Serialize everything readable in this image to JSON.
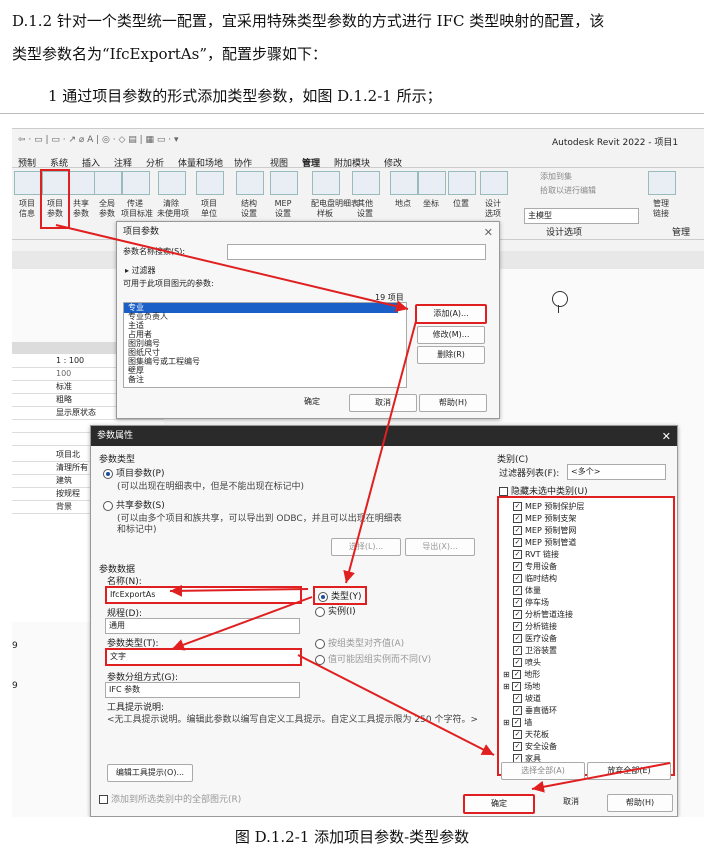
{
  "doc": {
    "para1_line1": "D.1.2  针对一个类型统一配置，宜采用特殊类型参数的方式进行 IFC 类型映射的配置，该",
    "para1_line2": "类型参数名为“IfcExportAs”，配置步骤如下：",
    "step1": "1 通过项目参数的形式添加类型参数，如图 D.1.2-1 所示；",
    "caption": "图 D.1.2-1 添加项目参数-类型参数"
  },
  "revit": {
    "title": "Autodesk Revit 2022 - 项目1",
    "tabs": [
      "预制",
      "系统",
      "插入",
      "注释",
      "分析",
      "体量和场地",
      "协作",
      "视图",
      "管理",
      "附加模块",
      "修改"
    ],
    "ribbon_buttons": [
      "项目\n信息",
      "项目\n参数",
      "共享\n参数",
      "全局\n参数",
      "传递\n项目标准",
      "清除\n未使用项",
      "项目\n单位",
      "结构\n设置",
      "MEP\n设置",
      "配电盘明细表\n样板",
      "其他\n设置",
      "地点",
      "坐标",
      "位置",
      "设计\n选项",
      "管理\n链接"
    ],
    "design_options": {
      "add_to_set": "添加到集",
      "pick_edit": "拾取以进行编辑",
      "main_model": "主模型",
      "group_label": "设计选项"
    },
    "manage_label": "管理",
    "properties": {
      "scale": "1 : 100",
      "scale_value": "100",
      "detail": "标准",
      "visual": "粗略",
      "display": "显示原状态",
      "rows2": [
        "项目北",
        "清理所有",
        "建筑",
        "按规程",
        "背景"
      ]
    },
    "left_marks": [
      "9",
      "9"
    ]
  },
  "project_params": {
    "title": "项目参数",
    "search_label": "参数名称搜索(S):",
    "filter_label": "过滤器",
    "available_label": "可用于此项目图元的参数:",
    "count": "19 项目",
    "items": [
      "专业",
      "专业负责人",
      "主适",
      "占用者",
      "图別编号",
      "图纸尺寸",
      "图集编号或工程编号",
      "壁厚",
      "备注"
    ],
    "add": "添加(A)...",
    "modify": "修改(M)...",
    "delete": "删除(R)",
    "ok": "确定",
    "cancel": "取消",
    "help": "帮助(H)"
  },
  "param_props": {
    "title": "参数属性",
    "param_type_label": "参数类型",
    "project_param": "项目参数(P)",
    "project_param_desc": "(可以出现在明细表中，但是不能出现在标记中)",
    "shared_param": "共享参数(S)",
    "shared_param_desc1": "(可以由多个项目和族共享，可以导出到 ODBC，并且可以出现在明细表",
    "shared_param_desc2": "和标记中)",
    "select_btn": "选择(L)...",
    "export_btn": "导出(X)...",
    "param_data": "参数数据",
    "name_label": "名称(N):",
    "name_value": "IfcExportAs",
    "type_radio": "类型(Y)",
    "instance_radio": "实例(I)",
    "discipline_label": "规程(D):",
    "discipline_value": "通用",
    "param_type_field_label": "参数类型(T):",
    "param_type_value": "文字",
    "group_by_type": "按组类型对齐值(A)",
    "group_by_instance": "值可能因组实例而不同(V)",
    "group_label": "参数分组方式(G):",
    "group_value": "IFC 参数",
    "tooltip_label": "工具提示说明:",
    "tooltip_value": "<无工具提示说明。编辑此参数以编写自定义工具提示。自定义工具提示限为 250 个字符。>",
    "edit_tooltip": "编辑工具提示(O)...",
    "add_to_all": "添加到所选类别中的全部图元(R)",
    "category_label": "类别(C)",
    "filter_list_label": "过滤器列表(F):",
    "filter_list_value": "<多个>",
    "hide_unchecked": "隐藏未选中类别(U)",
    "categories": [
      "MEP 预制保护层",
      "MEP 预制支架",
      "MEP 预制管网",
      "MEP 预制管道",
      "RVT 链接",
      "专用设备",
      "临时结构",
      "体量",
      "停车场",
      "分析管道连接",
      "分析链接",
      "医疗设备",
      "卫浴装置",
      "喷头",
      "地形",
      "场地",
      "坡道",
      "垂直循环",
      "墙",
      "天花板",
      "安全设备",
      "家具"
    ],
    "select_all": "选择全部(A)",
    "deselect_all": "放弃全部(E)",
    "ok": "确定",
    "cancel": "取消",
    "help": "帮助(H)"
  }
}
